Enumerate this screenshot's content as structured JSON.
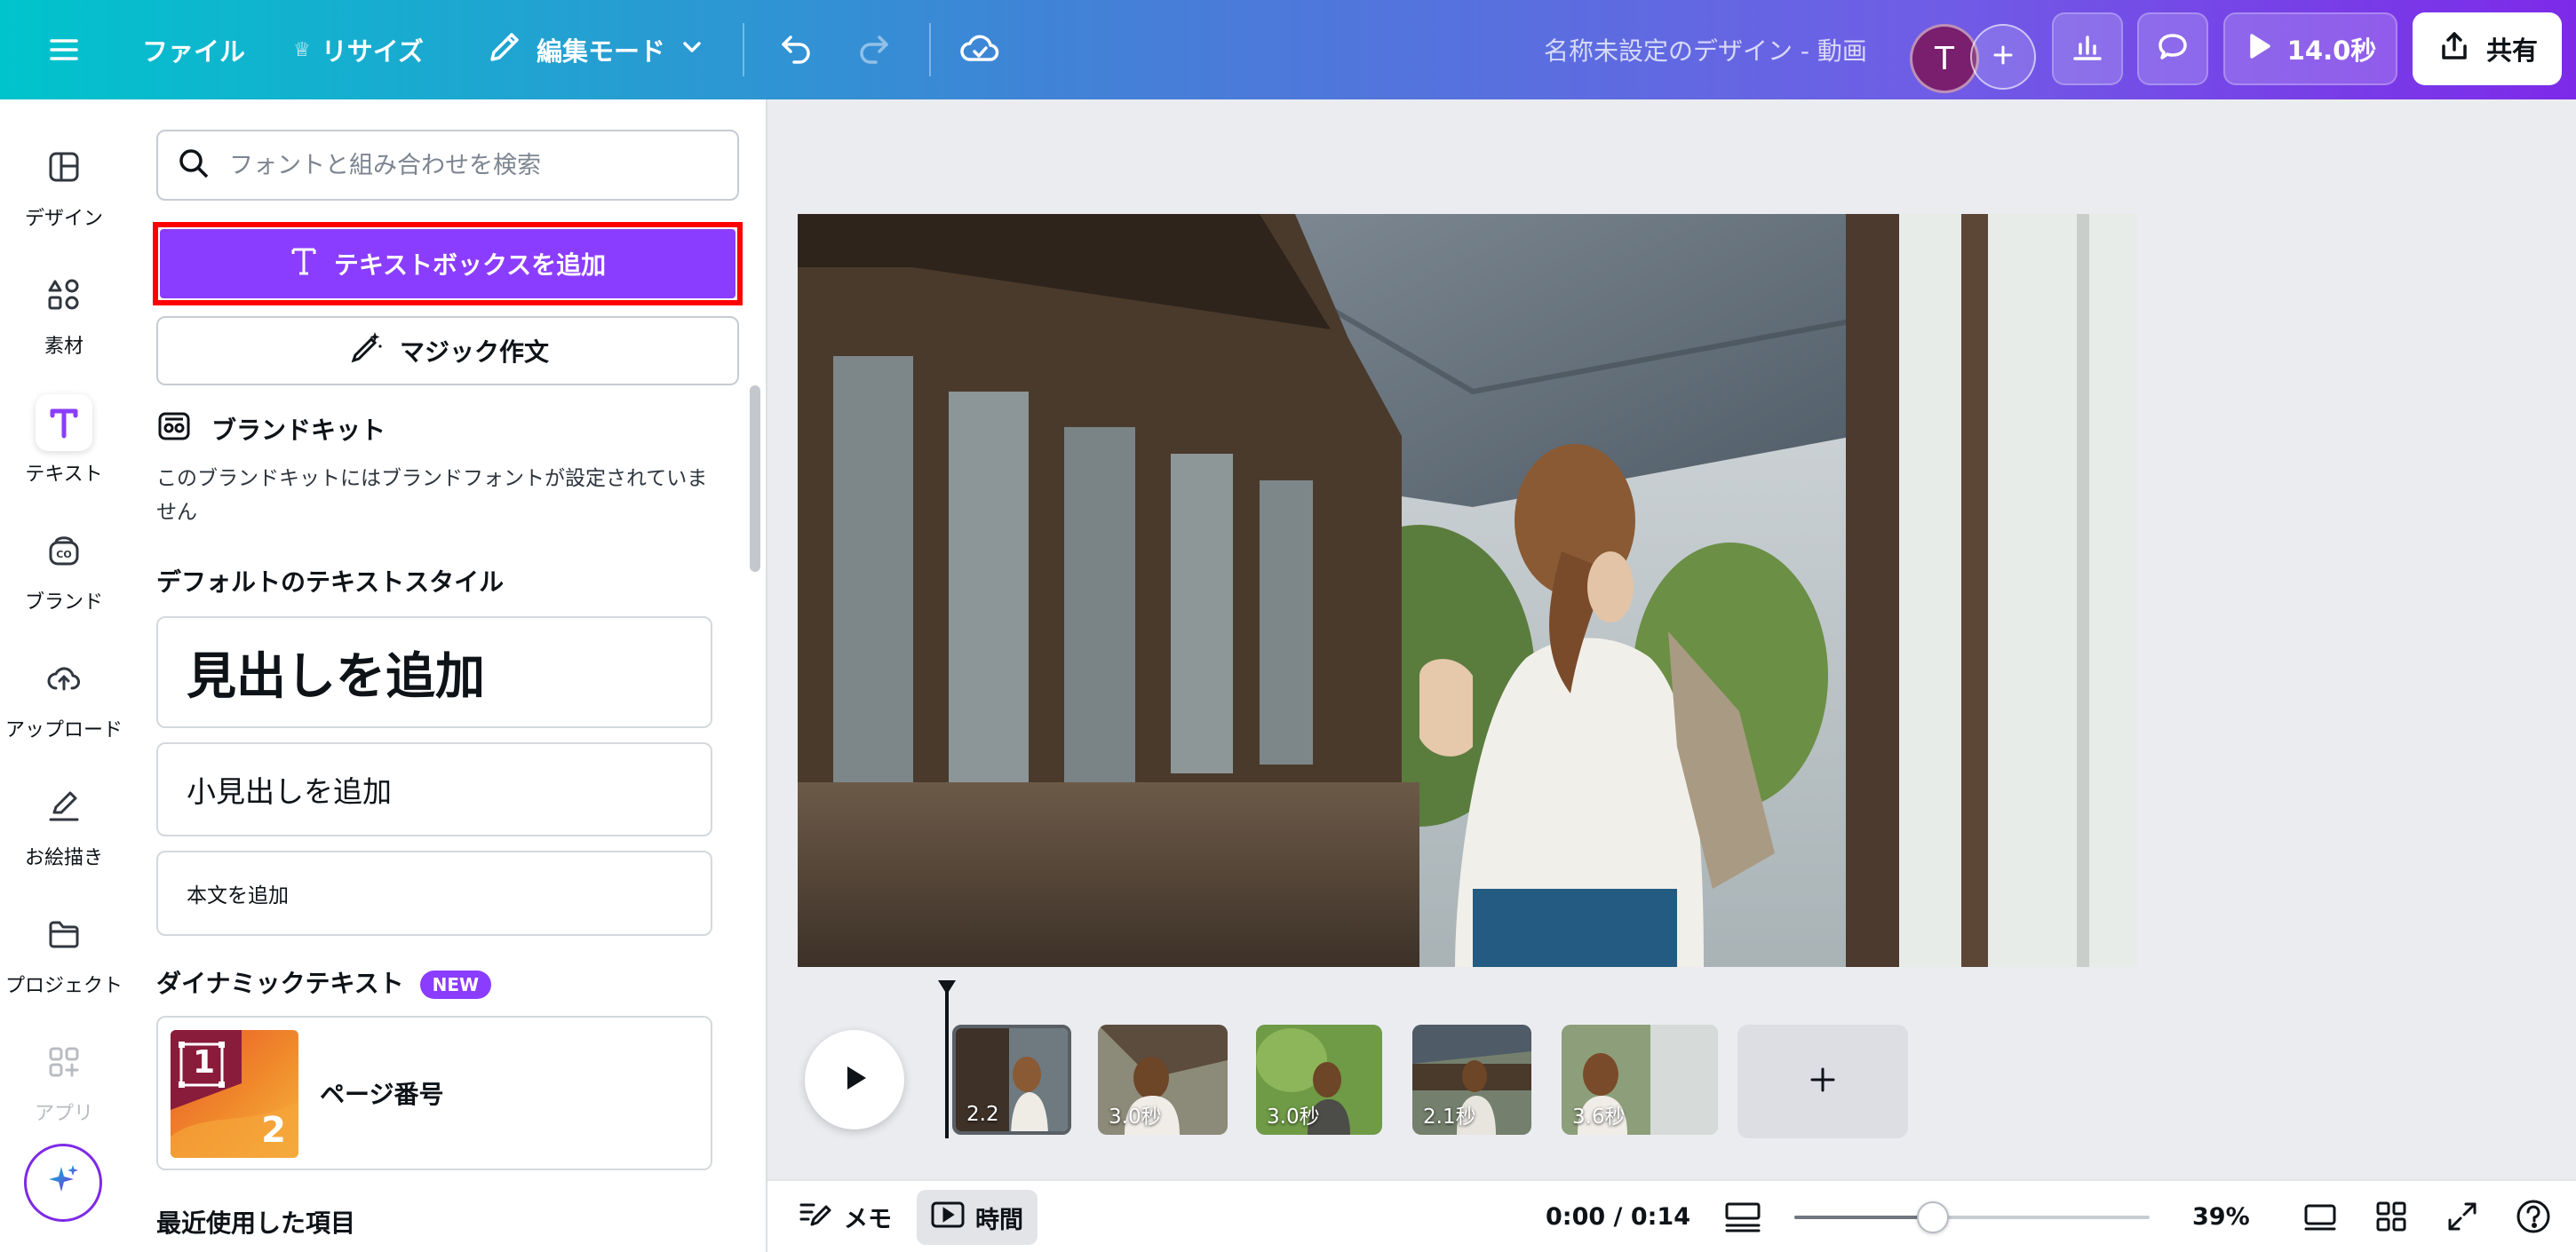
{
  "topbar": {
    "menu_icon": "hamburger-menu-icon",
    "file_label": "ファイル",
    "resize_label": "リサイズ",
    "edit_mode_label": "編集モード",
    "doc_title": "名称未設定のデザイン - 動画",
    "avatar_initial": "T",
    "play_duration": "14.0秒",
    "share_label": "共有"
  },
  "rail": {
    "items": [
      {
        "label": "デザイン",
        "icon": "layout-icon"
      },
      {
        "label": "素材",
        "icon": "shapes-icon"
      },
      {
        "label": "テキスト",
        "icon": "text-icon"
      },
      {
        "label": "ブランド",
        "icon": "brand-icon"
      },
      {
        "label": "アップロード",
        "icon": "cloud-upload-icon"
      },
      {
        "label": "お絵描き",
        "icon": "pen-icon"
      },
      {
        "label": "プロジェクト",
        "icon": "folder-icon"
      },
      {
        "label": "アプリ",
        "icon": "apps-icon"
      }
    ]
  },
  "panel": {
    "search_placeholder": "フォントと組み合わせを検索",
    "add_textbox_label": "テキストボックスを追加",
    "magic_write_label": "マジック作文",
    "brand_kit_title": "ブランドキット",
    "brand_kit_desc": "このブランドキットにはブランドフォントが設定されていません",
    "default_styles_title": "デフォルトのテキストスタイル",
    "heading_label": "見出しを追加",
    "subheading_label": "小見出しを追加",
    "body_label": "本文を追加",
    "dynamic_text_title": "ダイナミックテキスト",
    "new_badge": "NEW",
    "page_number_label": "ページ番号",
    "page_number_thumb_1": "1",
    "page_number_thumb_2": "2",
    "recent_title": "最近使用した項目"
  },
  "timeline": {
    "clips": [
      {
        "label": "2.2"
      },
      {
        "label": "3.0秒"
      },
      {
        "label": "3.0秒"
      },
      {
        "label": "2.1秒"
      },
      {
        "label": "3.6秒"
      }
    ]
  },
  "bottombar": {
    "notes_label": "メモ",
    "timer_label": "時間",
    "time_readout": "0:00 / 0:14",
    "zoom_percent": "39%",
    "zoom_fraction": 0.39
  },
  "colors": {
    "accent_purple": "#8b3dff",
    "highlight_red": "#ff0000",
    "topbar_gradient_start": "#00c4cc",
    "topbar_gradient_end": "#7d2ae8"
  }
}
